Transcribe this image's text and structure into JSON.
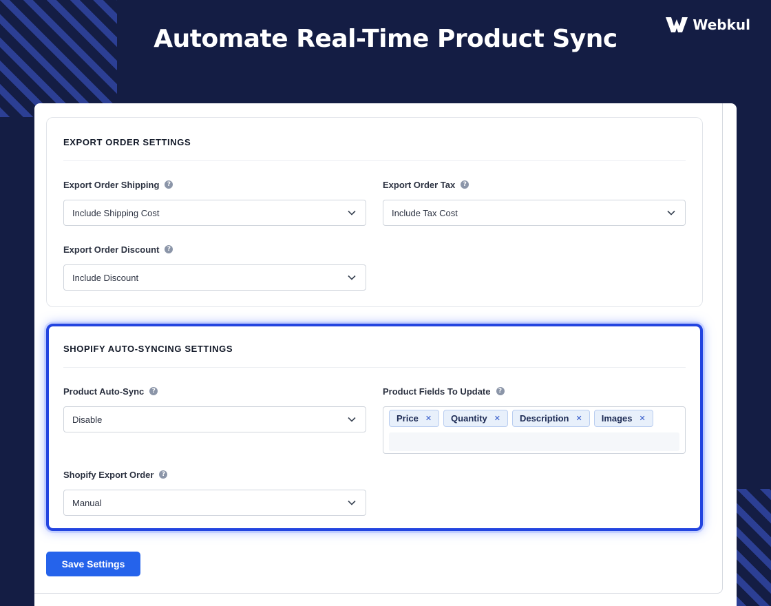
{
  "hero": {
    "title": "Automate Real-Time Product Sync"
  },
  "brand": {
    "name": "Webkul",
    "icon": "webkul-logo-icon"
  },
  "export_order": {
    "title": "EXPORT ORDER SETTINGS",
    "shipping": {
      "label": "Export Order Shipping",
      "value": "Include Shipping Cost"
    },
    "tax": {
      "label": "Export Order Tax",
      "value": "Include Tax Cost"
    },
    "discount": {
      "label": "Export Order Discount",
      "value": "Include Discount"
    }
  },
  "auto_sync": {
    "title": "SHOPIFY AUTO-SYNCING SETTINGS",
    "product_auto_sync": {
      "label": "Product Auto-Sync",
      "value": "Disable"
    },
    "fields_to_update": {
      "label": "Product Fields To Update",
      "tags": [
        "Price",
        "Quantity",
        "Description",
        "Images"
      ]
    },
    "export_order": {
      "label": "Shopify Export Order",
      "value": "Manual"
    }
  },
  "actions": {
    "save_label": "Save Settings"
  },
  "colors": {
    "background": "#141d44",
    "stripe": "#2c3f94",
    "accent_border": "#2344e0",
    "primary_button": "#2563eb",
    "tag_bg": "#e8f0fb"
  }
}
